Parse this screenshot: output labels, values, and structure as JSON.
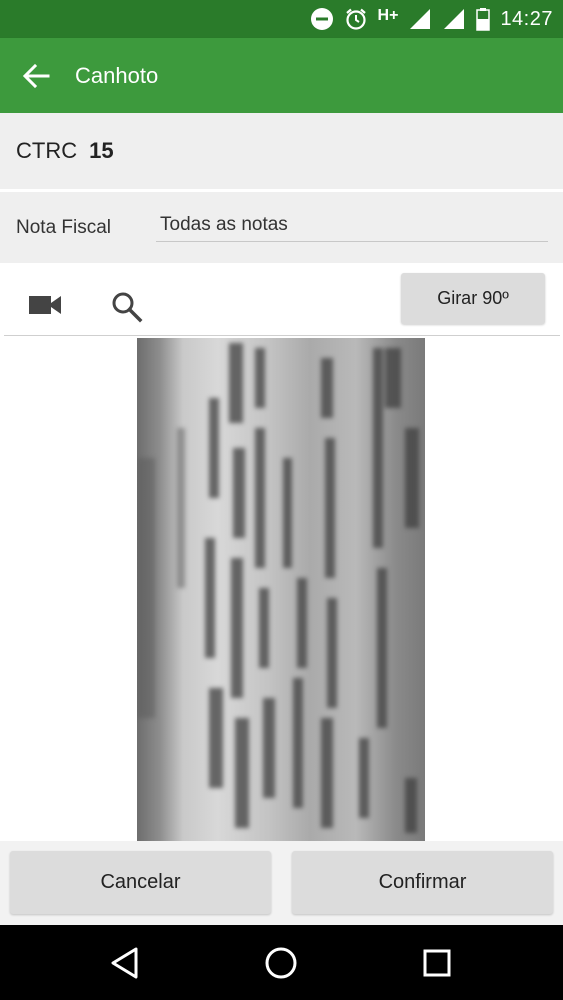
{
  "status_bar": {
    "network": "H+",
    "time": "14:27"
  },
  "app_bar": {
    "title": "Canhoto"
  },
  "ctrc": {
    "label": "CTRC",
    "value": "15"
  },
  "nota_fiscal": {
    "label": "Nota Fiscal",
    "selected": "Todas as notas"
  },
  "toolbar": {
    "rotate_label": "Girar 90º"
  },
  "actions": {
    "cancel_label": "Cancelar",
    "confirm_label": "Confirmar"
  },
  "colors": {
    "status_bar": "#2a7b2a",
    "app_bar": "#3d9a3d",
    "button": "#dcdcdc"
  },
  "icons": [
    "back-arrow-icon",
    "video-camera-icon",
    "search-icon",
    "do-not-disturb-icon",
    "alarm-icon",
    "signal-icon",
    "battery-icon",
    "nav-back-icon",
    "nav-home-icon",
    "nav-recent-icon"
  ]
}
